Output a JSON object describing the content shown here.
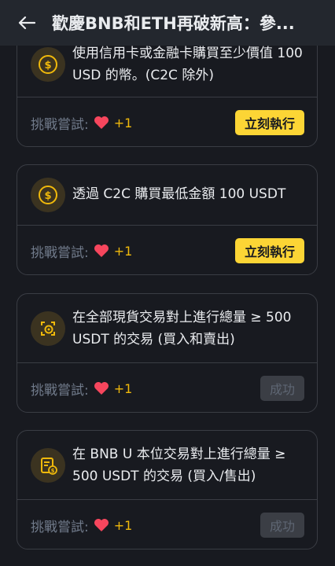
{
  "header": {
    "title": "歡慶BNB和ETH再破新高：參..."
  },
  "tasks": [
    {
      "text": "使用信用卡或金融卡購買至少價值 100 USD 的幣。(C2C 除外)",
      "try_label": "挑戰嘗試:",
      "reward": "+1",
      "button": "立刻執行",
      "state": "pending",
      "icon": "coin-icon"
    },
    {
      "text": "透過 C2C 購買最低金額 100 USDT",
      "try_label": "挑戰嘗試:",
      "reward": "+1",
      "button": "立刻執行",
      "state": "pending",
      "icon": "coin-icon"
    },
    {
      "text": "在全部現貨交易對上進行總量 ≥ 500 USDT 的交易 (買入和賣出)",
      "try_label": "挑戰嘗試:",
      "reward": "+1",
      "button": "成功",
      "state": "done",
      "icon": "spot-trade-icon"
    },
    {
      "text": "在 BNB U 本位交易對上進行總量 ≥ 500 USDT 的交易 (買入/售出)",
      "try_label": "挑戰嘗試:",
      "reward": "+1",
      "button": "成功",
      "state": "done",
      "icon": "futures-doc-icon"
    }
  ],
  "colors": {
    "accent": "#fcd535",
    "background": "#181a20",
    "heart": "#f6465d"
  }
}
